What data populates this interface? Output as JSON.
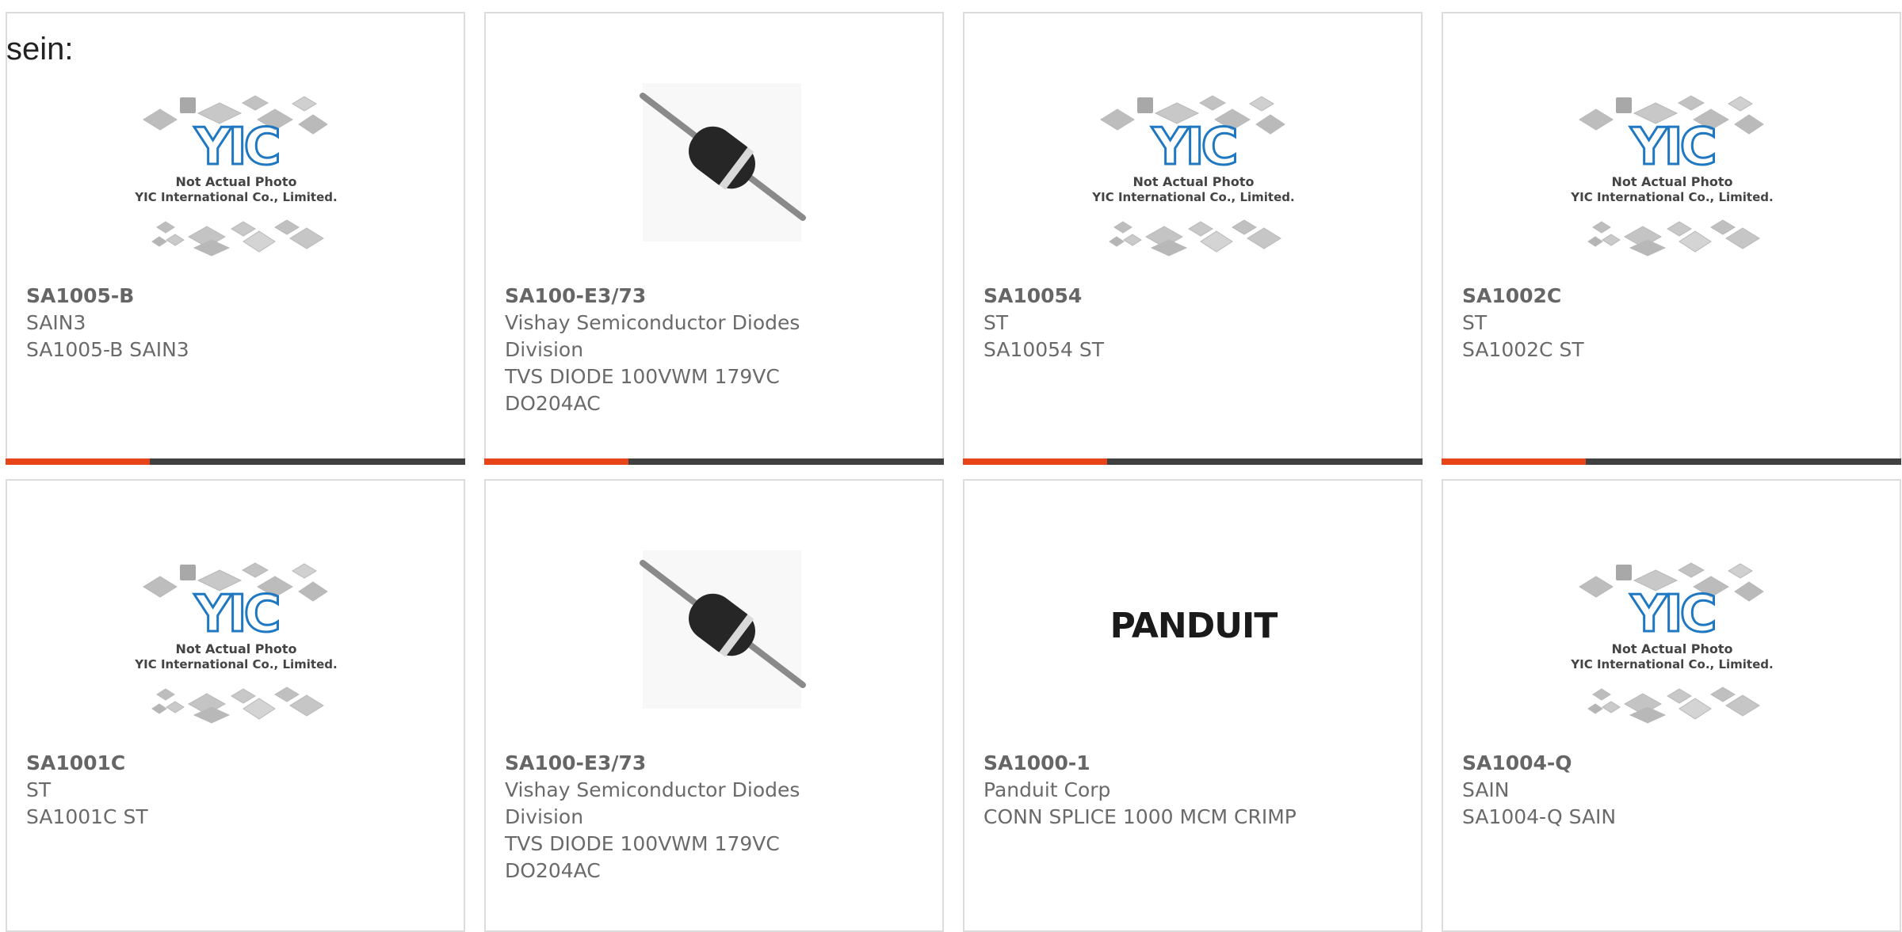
{
  "page": {
    "heading": "sein:"
  },
  "colors": {
    "accent": "#e8441a",
    "bar": "#404040",
    "border": "#dcdcdc",
    "logo_blue": "#1f78c1"
  },
  "placeholder": {
    "line1": "Not Actual Photo",
    "line2": "YIC International Co., Limited.",
    "logo": "YIC"
  },
  "panduit_logo": "PANDUIT",
  "products": [
    {
      "part": "SA1005-B",
      "lines": [
        "SAIN3",
        "SA1005-B SAIN3"
      ],
      "image": "yic-placeholder",
      "accent": true
    },
    {
      "part": "SA100-E3/73",
      "lines": [
        "Vishay Semiconductor Diodes",
        "Division",
        "TVS DIODE 100VWM 179VC",
        "DO204AC"
      ],
      "image": "diode",
      "accent": true
    },
    {
      "part": "SA10054",
      "lines": [
        "ST",
        "SA10054 ST"
      ],
      "image": "yic-placeholder",
      "accent": true
    },
    {
      "part": "SA1002C",
      "lines": [
        "ST",
        "SA1002C ST"
      ],
      "image": "yic-placeholder",
      "accent": true
    },
    {
      "part": "SA1001C",
      "lines": [
        "ST",
        "SA1001C ST"
      ],
      "image": "yic-placeholder",
      "accent": false
    },
    {
      "part": "SA100-E3/73",
      "lines": [
        "Vishay Semiconductor Diodes",
        "Division",
        "TVS DIODE 100VWM 179VC",
        "DO204AC"
      ],
      "image": "diode",
      "accent": false
    },
    {
      "part": "SA1000-1",
      "lines": [
        "Panduit Corp",
        "CONN SPLICE 1000 MCM CRIMP"
      ],
      "image": "panduit-logo",
      "accent": false
    },
    {
      "part": "SA1004-Q",
      "lines": [
        "SAIN",
        "SA1004-Q SAIN"
      ],
      "image": "yic-placeholder",
      "accent": false
    }
  ]
}
